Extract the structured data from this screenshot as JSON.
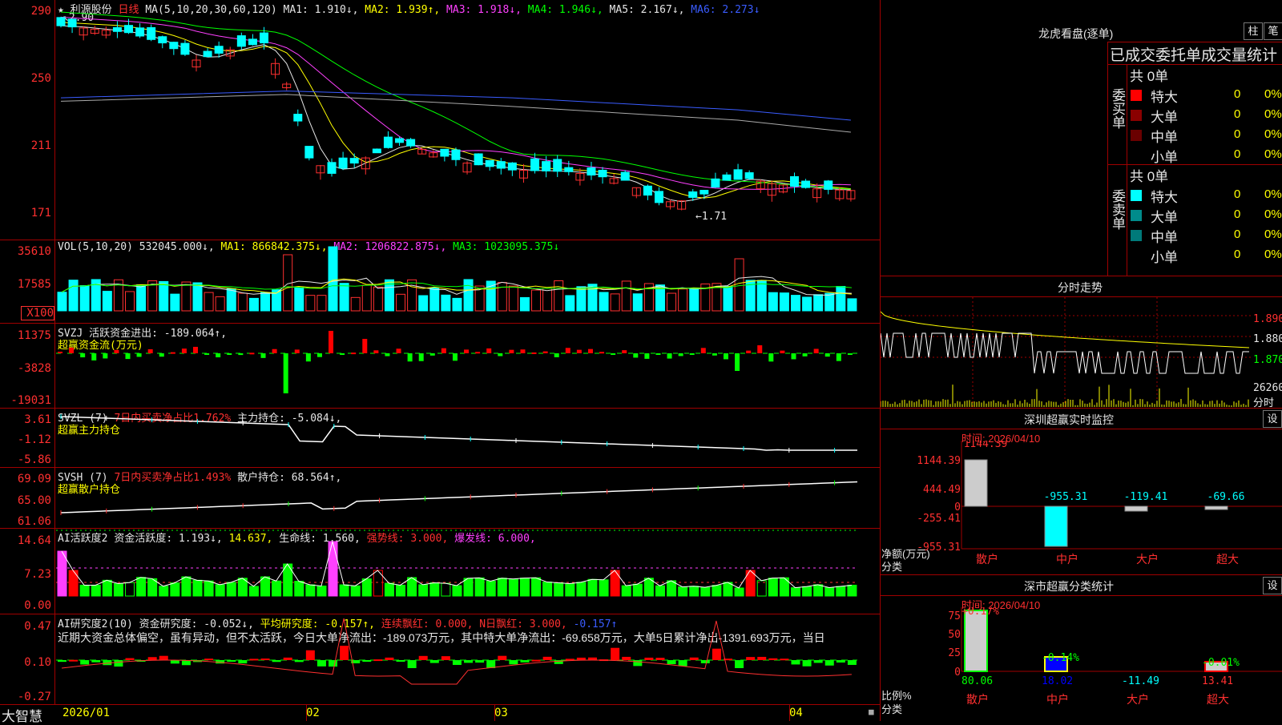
{
  "stock": {
    "name": "利源股份",
    "period": "日线",
    "ma_label": "MA(5,10,20,30,60,120)"
  },
  "price_axis": [
    "290",
    "250",
    "211",
    "171"
  ],
  "price_high_mark": "2.90",
  "price_low_mark": "1.71",
  "ma_values": {
    "ma1": "MA1: 1.910↓,",
    "ma2": "MA2: 1.939↑,",
    "ma3": "MA3: 1.918↓,",
    "ma4": "MA4: 1.946↓,",
    "ma5": "MA5: 2.167↓,",
    "ma6": "MA6: 2.273↓"
  },
  "vol": {
    "label": "VOL(5,10,20)",
    "value": "532045.000↓,",
    "ma1": "MA1: 866842.375↓,",
    "ma2": "MA2: 1206822.875↓,",
    "ma3": "MA3: 1023095.375↓",
    "axis": [
      "35610",
      "17585",
      "X100"
    ]
  },
  "svzj": {
    "label": "SVZJ",
    "text": "活跃资金进出: -189.064↑,",
    "sub": "超赢资金流(万元)",
    "axis": [
      "11375",
      "-3828",
      "-19031"
    ]
  },
  "svzl": {
    "label": "SVZL (7)",
    "ratio": "7日内买卖净占比1.762%",
    "text": "主力持仓: -5.084↓,",
    "sub": "超赢主力持仓",
    "axis": [
      "3.61",
      "-1.12",
      "-5.86"
    ]
  },
  "svsh": {
    "label": "SVSH (7)",
    "ratio": "7日内买卖净占比1.493%",
    "text": "散户持仓: 68.564↑,",
    "sub": "超赢散户持仓",
    "axis": [
      "69.09",
      "65.00",
      "61.06"
    ]
  },
  "ai1": {
    "label": "AI活跃度2",
    "t1": "资金活跃度: 1.193↓,",
    "t2": "14.637,",
    "t3": "生命线: 1.560,",
    "t4": "强势线: 3.000,",
    "t5": "爆发线: 6.000,",
    "axis": [
      "14.64",
      "7.23",
      "0.00"
    ]
  },
  "ai2": {
    "label": "AI研究度2(10)",
    "t1": "资金研究度: -0.052↓,",
    "t2": "平均研究度: -0.157↑,",
    "t3": "连续飘红: 0.000,",
    "t4": "N日飘红: 3.000,",
    "t5": "-0.157↑",
    "axis": [
      "0.47",
      "0.10",
      "-0.27"
    ],
    "comment": "近期大资金总体偏空，虽有异动，但不太活跃，今日大单净流出：-189.073万元，其中特大单净流出：-69.658万元，大单5日累计净出-1391.693万元，当日"
  },
  "date_axis": [
    "2026/01",
    "02",
    "03",
    "04"
  ],
  "logo": "大智慧",
  "lhb": {
    "title": "龙虎看盘(逐单)",
    "btn_bar": "柱",
    "btn_pen": "笔",
    "stats_title": "已成交委托单成交量统计",
    "buy_label": "委买单",
    "sell_label": "委卖单",
    "buy_total": "共 0单",
    "sell_total": "共 0单",
    "buy_rows": [
      {
        "label": "特大",
        "count": "0",
        "pct": "0%"
      },
      {
        "label": "大单",
        "count": "0",
        "pct": "0%"
      },
      {
        "label": "中单",
        "count": "0",
        "pct": "0%"
      },
      {
        "label": "小单",
        "count": "0",
        "pct": "0%"
      }
    ],
    "sell_rows": [
      {
        "label": "特大",
        "count": "0",
        "pct": "0%"
      },
      {
        "label": "大单",
        "count": "0",
        "pct": "0%"
      },
      {
        "label": "中单",
        "count": "0",
        "pct": "0%"
      },
      {
        "label": "小单",
        "count": "0",
        "pct": "0%"
      }
    ]
  },
  "intraday": {
    "title": "分时走势",
    "axis": [
      "1.890",
      "1.880",
      "1.870"
    ],
    "vol_max": "26260",
    "vol_label": "分时"
  },
  "monitor": {
    "title": "深圳超赢实时监控",
    "btn": "设",
    "time": "时间: 2026/04/10",
    "unit": "净额(万元)",
    "cat_label": "分类",
    "axis": [
      "1144.39",
      "444.49",
      "0",
      "-255.41",
      "-955.31"
    ],
    "categories": [
      "散户",
      "中户",
      "大户",
      "超大"
    ],
    "values": [
      "1144.39",
      "-955.31",
      "-119.41",
      "-69.66"
    ]
  },
  "classify": {
    "title": "深市超赢分类统计",
    "btn": "设",
    "time": "时间: 2026/04/10",
    "axis": [
      "75",
      "50",
      "25",
      "0"
    ],
    "unit": "比例%",
    "cat_label": "分类",
    "top": [
      "+0.17%",
      "-0.14%",
      "-0.01%"
    ],
    "bottom": [
      "80.06",
      "18.02",
      "-11.49",
      "13.41"
    ],
    "categories": [
      "散户",
      "中户",
      "大户",
      "超大"
    ]
  },
  "chart_data": {
    "type": "candlestick",
    "title": "利源股份 日线",
    "x_ticks": [
      "2026/01",
      "02",
      "03",
      "04"
    ],
    "ylim": [
      1.71,
      2.9
    ],
    "y_ticks": [
      2.9,
      2.5,
      2.11,
      1.71
    ],
    "high": 2.9,
    "low": 1.71,
    "last_ma": {
      "MA5": 1.91,
      "MA10": 1.939,
      "MA20": 1.918,
      "MA30": 1.946,
      "MA60": 2.167,
      "MA120": 2.273
    },
    "volume_last": 532045.0,
    "colors": {
      "up": "#ff3030",
      "down": "#00ffff",
      "ma5": "#e6e6e6",
      "ma10": "#ffff00",
      "ma20": "#ff40ff",
      "ma30": "#00ff00",
      "ma60": "#3a5cff",
      "ma120": "#aaaaaa"
    }
  }
}
